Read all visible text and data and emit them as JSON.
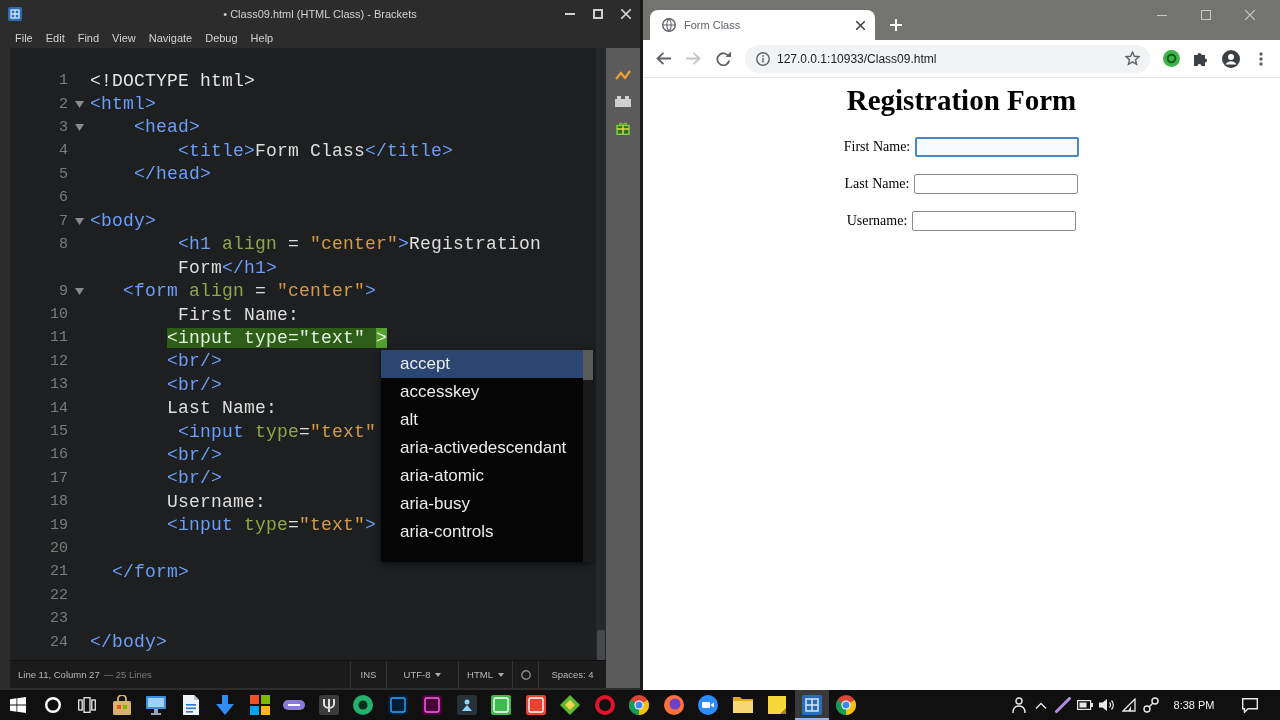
{
  "editor_window": {
    "title": "• Class09.html (HTML Class) - Brackets",
    "menu": [
      "File",
      "Edit",
      "Find",
      "View",
      "Navigate",
      "Debug",
      "Help"
    ],
    "code_lines": [
      {
        "number": "1",
        "fold": false,
        "rows": [
          [
            {
              "text": "<!DOCTYPE html>",
              "kind": "meta"
            }
          ]
        ]
      },
      {
        "number": "2",
        "fold": true,
        "rows": [
          [
            {
              "text": "<html>",
              "kind": "tag"
            }
          ]
        ]
      },
      {
        "number": "3",
        "fold": true,
        "rows": [
          [
            {
              "text": "    <head>",
              "kind": "tag"
            }
          ]
        ]
      },
      {
        "number": "4",
        "fold": false,
        "rows": [
          [
            {
              "text": "        <title>",
              "kind": "tag"
            },
            {
              "text": "Form Class",
              "kind": "plain"
            },
            {
              "text": "</title>",
              "kind": "tag"
            }
          ]
        ]
      },
      {
        "number": "5",
        "fold": false,
        "rows": [
          [
            {
              "text": "    </head>",
              "kind": "tag"
            }
          ]
        ]
      },
      {
        "number": "6",
        "fold": false
      },
      {
        "number": "7",
        "fold": true,
        "rows": [
          [
            {
              "text": "<body>",
              "kind": "tag"
            }
          ]
        ]
      },
      {
        "number": "8",
        "fold": false,
        "rows": [
          [
            {
              "text": "        <h1",
              "kind": "tag"
            },
            {
              "text": " align",
              "kind": "attr"
            },
            {
              "text": " = ",
              "kind": "plain"
            },
            {
              "text": "\"center\"",
              "kind": "string"
            },
            {
              "text": ">",
              "kind": "tag"
            },
            {
              "text": "Registration",
              "kind": "plain"
            }
          ],
          [
            {
              "text": "        Form",
              "kind": "plain"
            },
            {
              "text": "</h1>",
              "kind": "tag"
            }
          ]
        ]
      },
      {
        "number": "9",
        "fold": true,
        "rows": [
          [
            {
              "text": "   <form",
              "kind": "tag"
            },
            {
              "text": " align",
              "kind": "attr"
            },
            {
              "text": " = ",
              "kind": "plain"
            },
            {
              "text": "\"center\"",
              "kind": "string"
            },
            {
              "text": ">",
              "kind": "tag"
            }
          ]
        ]
      },
      {
        "number": "10",
        "fold": false,
        "rows": [
          [
            {
              "text": "        First Name:",
              "kind": "plain"
            }
          ]
        ]
      },
      {
        "number": "11",
        "fold": false,
        "rows": [
          [
            {
              "text": "       <input type=\"text\" ",
              "kind": "match"
            },
            {
              "text": ">",
              "kind": "match-end"
            }
          ]
        ]
      },
      {
        "number": "12",
        "fold": false,
        "rows": [
          [
            {
              "text": "       <br/>",
              "kind": "tag"
            }
          ]
        ]
      },
      {
        "number": "13",
        "fold": false,
        "rows": [
          [
            {
              "text": "       <br/>",
              "kind": "tag"
            }
          ]
        ]
      },
      {
        "number": "14",
        "fold": false,
        "rows": [
          [
            {
              "text": "       Last Name:",
              "kind": "plain"
            }
          ]
        ]
      },
      {
        "number": "15",
        "fold": false,
        "rows": [
          [
            {
              "text": "        <input",
              "kind": "tag"
            },
            {
              "text": " type",
              "kind": "attr"
            },
            {
              "text": "=",
              "kind": "plain"
            },
            {
              "text": "\"text\"",
              "kind": "string"
            }
          ]
        ]
      },
      {
        "number": "16",
        "fold": false,
        "rows": [
          [
            {
              "text": "       <br/>",
              "kind": "tag"
            }
          ]
        ]
      },
      {
        "number": "17",
        "fold": false,
        "rows": [
          [
            {
              "text": "       <br/>",
              "kind": "tag"
            }
          ]
        ]
      },
      {
        "number": "18",
        "fold": false,
        "rows": [
          [
            {
              "text": "       Username:",
              "kind": "plain"
            }
          ]
        ]
      },
      {
        "number": "19",
        "fold": false,
        "rows": [
          [
            {
              "text": "       <input",
              "kind": "tag"
            },
            {
              "text": " type",
              "kind": "attr"
            },
            {
              "text": "=",
              "kind": "plain"
            },
            {
              "text": "\"text\"",
              "kind": "string"
            },
            {
              "text": ">",
              "kind": "tag"
            }
          ]
        ]
      },
      {
        "number": "20",
        "fold": false
      },
      {
        "number": "21",
        "fold": false,
        "rows": [
          [
            {
              "text": "  </form>",
              "kind": "tag"
            }
          ]
        ]
      },
      {
        "number": "22",
        "fold": false
      },
      {
        "number": "23",
        "fold": false
      },
      {
        "number": "24",
        "fold": false,
        "rows": [
          [
            {
              "text": "</body>",
              "kind": "tag"
            }
          ]
        ]
      }
    ],
    "completion": [
      {
        "text": "accept",
        "selected": true
      },
      {
        "text": "accesskey",
        "selected": false
      },
      {
        "text": "alt",
        "selected": false
      },
      {
        "text": "aria-activedescendant",
        "selected": false
      },
      {
        "text": "aria-atomic",
        "selected": false
      },
      {
        "text": "aria-busy",
        "selected": false
      },
      {
        "text": "aria-controls",
        "selected": false
      }
    ],
    "status_bar": {
      "cursor": "Line 11, Column 27",
      "line_count": "— 25 Lines",
      "mode": "INS",
      "encoding": "UTF-8",
      "language": "HTML",
      "indent": "Spaces: 4"
    }
  },
  "browser_window": {
    "tabs": [
      {
        "title": "Form Class",
        "selected": true
      }
    ],
    "address": "127.0.0.1:10933/Class09.html",
    "page": {
      "heading": "Registration Form",
      "fields": [
        {
          "label": "First Name:",
          "focused": true
        },
        {
          "label": "Last Name:",
          "focused": false
        },
        {
          "label": "Username:",
          "focused": false
        }
      ]
    }
  },
  "taskbar": {
    "apps": [
      {
        "selected": false
      },
      {
        "selected": false
      },
      {
        "selected": false
      },
      {
        "selected": false
      },
      {
        "selected": false
      },
      {
        "selected": false
      },
      {
        "selected": false
      },
      {
        "selected": false
      },
      {
        "selected": false
      },
      {
        "selected": false
      },
      {
        "selected": false
      },
      {
        "selected": false
      },
      {
        "selected": false
      },
      {
        "selected": false
      },
      {
        "selected": false
      },
      {
        "selected": false
      },
      {
        "selected": false
      },
      {
        "selected": false
      },
      {
        "selected": false
      },
      {
        "selected": false
      },
      {
        "selected": true
      },
      {
        "selected": false
      }
    ],
    "clock": "8:38 PM"
  }
}
